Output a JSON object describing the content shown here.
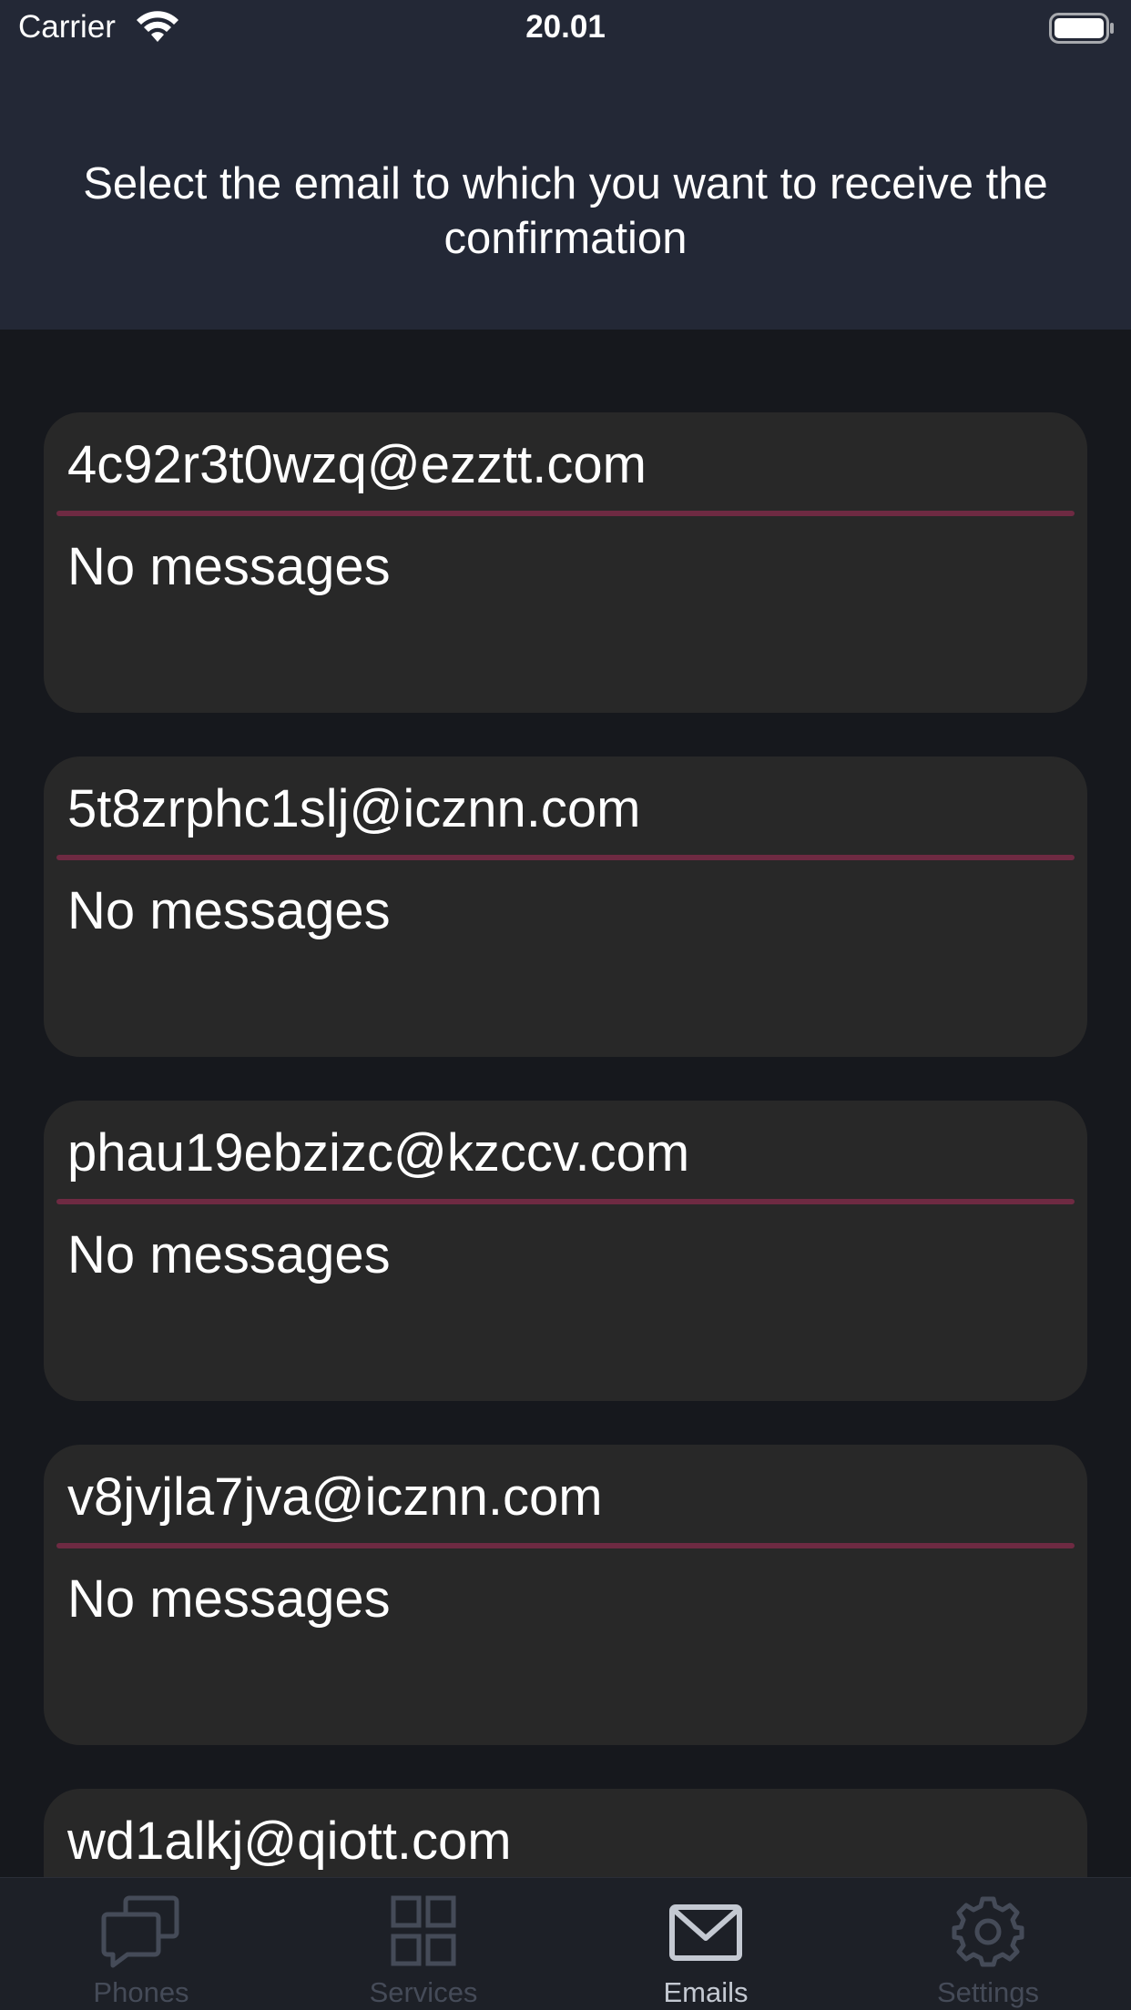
{
  "status_bar": {
    "carrier": "Carrier",
    "time": "20.01"
  },
  "header": {
    "title": "Select the email to which you want to receive the confirmation"
  },
  "emails": [
    {
      "address": "4c92r3t0wzq@ezztt.com",
      "status": "No messages"
    },
    {
      "address": "5t8zrphc1slj@icznn.com",
      "status": "No messages"
    },
    {
      "address": "phau19ebzizc@kzccv.com",
      "status": "No messages"
    },
    {
      "address": "v8jvjla7jva@icznn.com",
      "status": "No messages"
    },
    {
      "address": "wd1alkj@qiott.com",
      "status": ""
    }
  ],
  "tabs": [
    {
      "label": "Phones",
      "icon": "chat-bubbles-icon",
      "active": false
    },
    {
      "label": "Services",
      "icon": "grid-icon",
      "active": false
    },
    {
      "label": "Emails",
      "icon": "envelope-icon",
      "active": true
    },
    {
      "label": "Settings",
      "icon": "gear-icon",
      "active": false
    }
  ],
  "colors": {
    "header_bg": "#232836",
    "page_bg": "#16181d",
    "card_bg": "#282828",
    "divider": "#6e2a42",
    "tab_inactive": "#454b58",
    "tab_active": "#c4c9d2"
  }
}
